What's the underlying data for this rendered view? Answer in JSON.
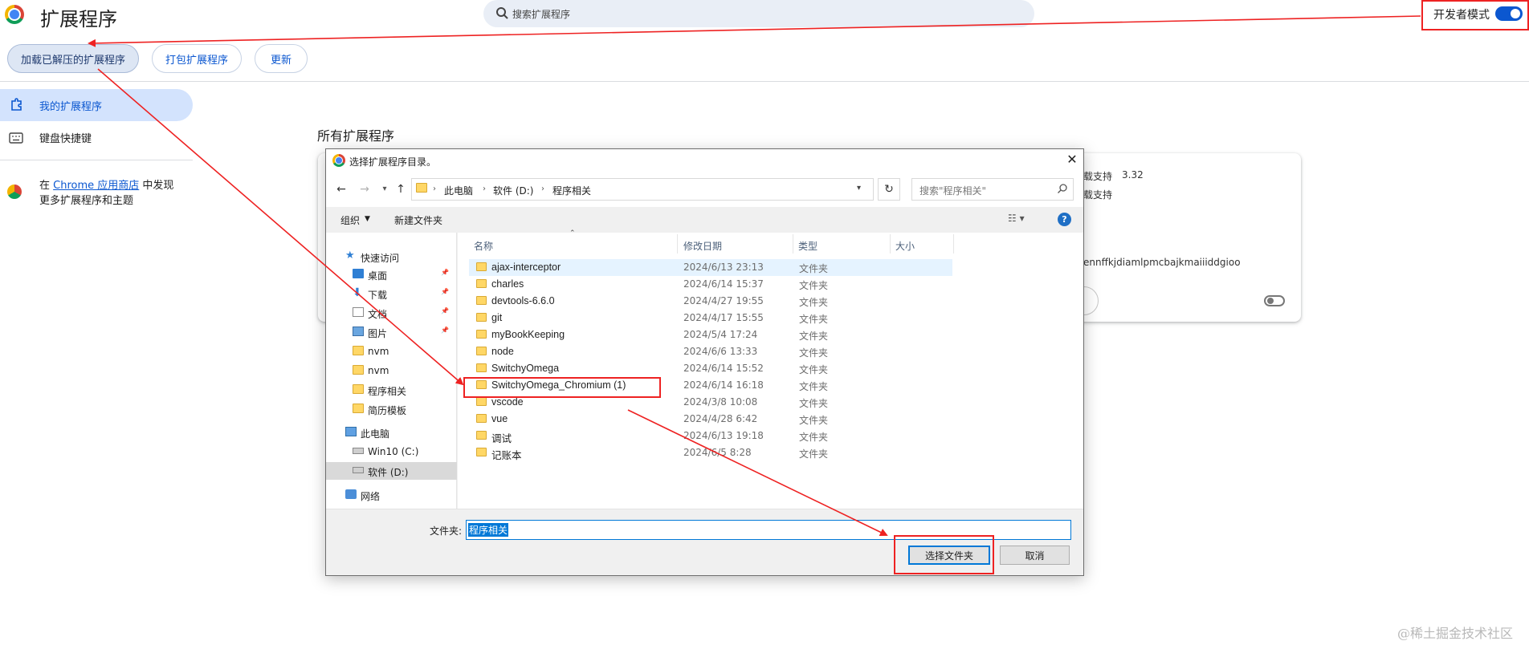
{
  "page": {
    "title": "扩展程序",
    "search_placeholder": "搜索扩展程序",
    "dev_mode_label": "开发者模式",
    "dev_mode_on": true,
    "buttons": {
      "load_unpacked": "加载已解压的扩展程序",
      "pack": "打包扩展程序",
      "update": "更新"
    },
    "sidebar": {
      "my_extensions": "我的扩展程序",
      "shortcuts": "键盘快捷键",
      "store_prefix": "在 ",
      "store_link": "Chrome 应用商店",
      "store_suffix": " 中发现",
      "store_line2": "更多扩展程序和主题"
    },
    "section_heading": "所有扩展程序",
    "card": {
      "line1": "载支持",
      "version": "3.32",
      "line2": "载支持",
      "id_fragment": "ennffkjdiamlpmcbajkmaiiiddgioo",
      "enabled": false
    }
  },
  "dialog": {
    "title": "选择扩展程序目录。",
    "breadcrumb": [
      "此电脑",
      "软件 (D:)",
      "程序相关"
    ],
    "search_placeholder": "搜索\"程序相关\"",
    "toolbar": {
      "organize": "组织",
      "new_folder": "新建文件夹"
    },
    "columns": {
      "name": "名称",
      "modified": "修改日期",
      "type": "类型",
      "size": "大小"
    },
    "nav_tree": [
      {
        "label": "快速访问",
        "icon": "star-icon",
        "indent": 0,
        "pinned": false
      },
      {
        "label": "桌面",
        "icon": "desktop-icon",
        "indent": 1,
        "pinned": true
      },
      {
        "label": "下载",
        "icon": "download-icon",
        "indent": 1,
        "pinned": true
      },
      {
        "label": "文档",
        "icon": "document-icon",
        "indent": 1,
        "pinned": true
      },
      {
        "label": "图片",
        "icon": "picture-icon",
        "indent": 1,
        "pinned": true
      },
      {
        "label": "nvm",
        "icon": "folder-icon",
        "indent": 1,
        "pinned": false
      },
      {
        "label": "nvm",
        "icon": "folder-icon",
        "indent": 1,
        "pinned": false
      },
      {
        "label": "程序相关",
        "icon": "folder-icon",
        "indent": 1,
        "pinned": false
      },
      {
        "label": "简历模板",
        "icon": "folder-icon",
        "indent": 1,
        "pinned": false
      },
      {
        "label": "此电脑",
        "icon": "computer-icon",
        "indent": 0,
        "pinned": false
      },
      {
        "label": "Win10 (C:)",
        "icon": "drive-icon",
        "indent": 1,
        "pinned": false
      },
      {
        "label": "软件 (D:)",
        "icon": "drive-icon",
        "indent": 1,
        "pinned": false,
        "selected": true
      },
      {
        "label": "网络",
        "icon": "network-icon",
        "indent": 0,
        "pinned": false
      }
    ],
    "files": [
      {
        "name": "ajax-interceptor",
        "date": "2024/6/13 23:13",
        "type": "文件夹"
      },
      {
        "name": "charles",
        "date": "2024/6/14 15:37",
        "type": "文件夹"
      },
      {
        "name": "devtools-6.6.0",
        "date": "2024/4/27 19:55",
        "type": "文件夹"
      },
      {
        "name": "git",
        "date": "2024/4/17 15:55",
        "type": "文件夹"
      },
      {
        "name": "myBookKeeping",
        "date": "2024/5/4 17:24",
        "type": "文件夹"
      },
      {
        "name": "node",
        "date": "2024/6/6 13:33",
        "type": "文件夹"
      },
      {
        "name": "SwitchyOmega",
        "date": "2024/6/14 15:52",
        "type": "文件夹"
      },
      {
        "name": "SwitchyOmega_Chromium (1)",
        "date": "2024/6/14 16:18",
        "type": "文件夹"
      },
      {
        "name": "vscode",
        "date": "2024/3/8 10:08",
        "type": "文件夹"
      },
      {
        "name": "vue",
        "date": "2024/4/28 6:42",
        "type": "文件夹"
      },
      {
        "name": "调试",
        "date": "2024/6/13 19:18",
        "type": "文件夹"
      },
      {
        "name": "记账本",
        "date": "2024/6/5 8:28",
        "type": "文件夹"
      }
    ],
    "folder_label": "文件夹:",
    "folder_value": "程序相关",
    "select_button": "选择文件夹",
    "cancel_button": "取消"
  },
  "watermark": "@稀土掘金技术社区",
  "colors": {
    "accent": "#0b57d0",
    "annotation": "#e22222",
    "selection": "#0078d7"
  }
}
